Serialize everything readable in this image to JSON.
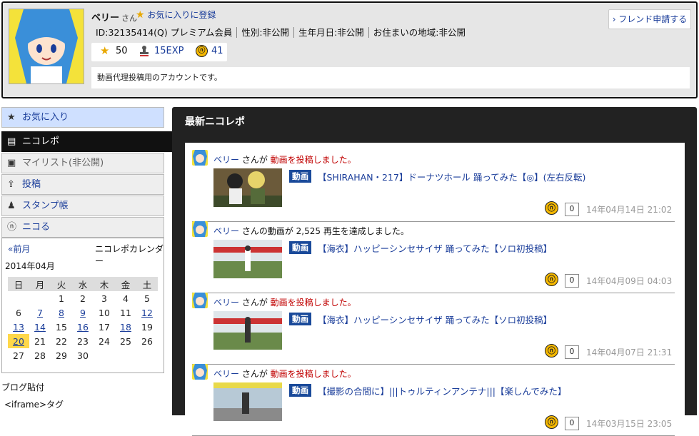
{
  "header": {
    "username": "ベリー",
    "honorific": "さん",
    "favorite_label": "お気に入りに登録",
    "meta": [
      "ID:32135414(Q) プレミアム会員",
      "性別:非公開",
      "生年月日:非公開",
      "お住まいの地域:非公開"
    ],
    "stats": {
      "stars": "50",
      "exp": "15EXP",
      "nicoru": "41"
    },
    "description": "動画代理投稿用のアカウントです。",
    "friend_button": "› フレンド申請する"
  },
  "sidebar": {
    "items": [
      {
        "label": "お気に入り",
        "icon": "star-icon"
      },
      {
        "label": "ニコレポ",
        "icon": "document-icon"
      },
      {
        "label": "マイリスト(非公開)",
        "icon": "folder-plus-icon"
      },
      {
        "label": "投稿",
        "icon": "upload-icon"
      },
      {
        "label": "スタンプ帳",
        "icon": "stamp-icon"
      },
      {
        "label": "ニコる",
        "icon": "nicoru-icon"
      }
    ]
  },
  "calendar": {
    "prev": "«前月",
    "title": "ニコレポカレンダー",
    "year_month": "2014年04月",
    "weekdays": [
      "日",
      "月",
      "火",
      "水",
      "木",
      "金",
      "土"
    ],
    "today": "20",
    "linked": [
      "7",
      "8",
      "9",
      "12",
      "13",
      "14",
      "16",
      "18",
      "20"
    ],
    "weeks": [
      [
        "",
        "",
        "1",
        "2",
        "3",
        "4",
        "5"
      ],
      [
        "6",
        "7",
        "8",
        "9",
        "10",
        "11",
        "12"
      ],
      [
        "13",
        "14",
        "15",
        "16",
        "17",
        "18",
        "19"
      ],
      [
        "20",
        "21",
        "22",
        "23",
        "24",
        "25",
        "26"
      ],
      [
        "27",
        "28",
        "29",
        "30",
        "",
        "",
        ""
      ]
    ]
  },
  "blog": {
    "label": "ブログ貼付",
    "iframe_label": "<iframe>タグ"
  },
  "main": {
    "title": "最新ニコレポ",
    "entries": [
      {
        "user": "ベリー",
        "pre": " さんが ",
        "action": "動画を投稿しました。",
        "plain": "",
        "tag": "動画",
        "title": "【SHIRAHAN・217】ドーナツホール 踊ってみた【◎】(左右反転)",
        "count": "0",
        "time": "14年04月14日 21:02"
      },
      {
        "user": "ベリー",
        "pre": " さんの動画が 2,525 再生を達成しました。",
        "action": "",
        "plain": "",
        "tag": "動画",
        "title": "【海衣】ハッピーシンセサイザ 踊ってみた【ソロ初投稿】",
        "count": "0",
        "time": "14年04月09日 04:03"
      },
      {
        "user": "ベリー",
        "pre": " さんが ",
        "action": "動画を投稿しました。",
        "plain": "",
        "tag": "動画",
        "title": "【海衣】ハッピーシンセサイザ 踊ってみた【ソロ初投稿】",
        "count": "0",
        "time": "14年04月07日 21:31"
      },
      {
        "user": "ベリー",
        "pre": " さんが ",
        "action": "動画を投稿しました。",
        "plain": "",
        "tag": "動画",
        "title": "【撮影の合間に】|||トゥルティンアンテナ|||【楽しんでみた】",
        "count": "0",
        "time": "14年03月15日 23:05"
      }
    ]
  }
}
